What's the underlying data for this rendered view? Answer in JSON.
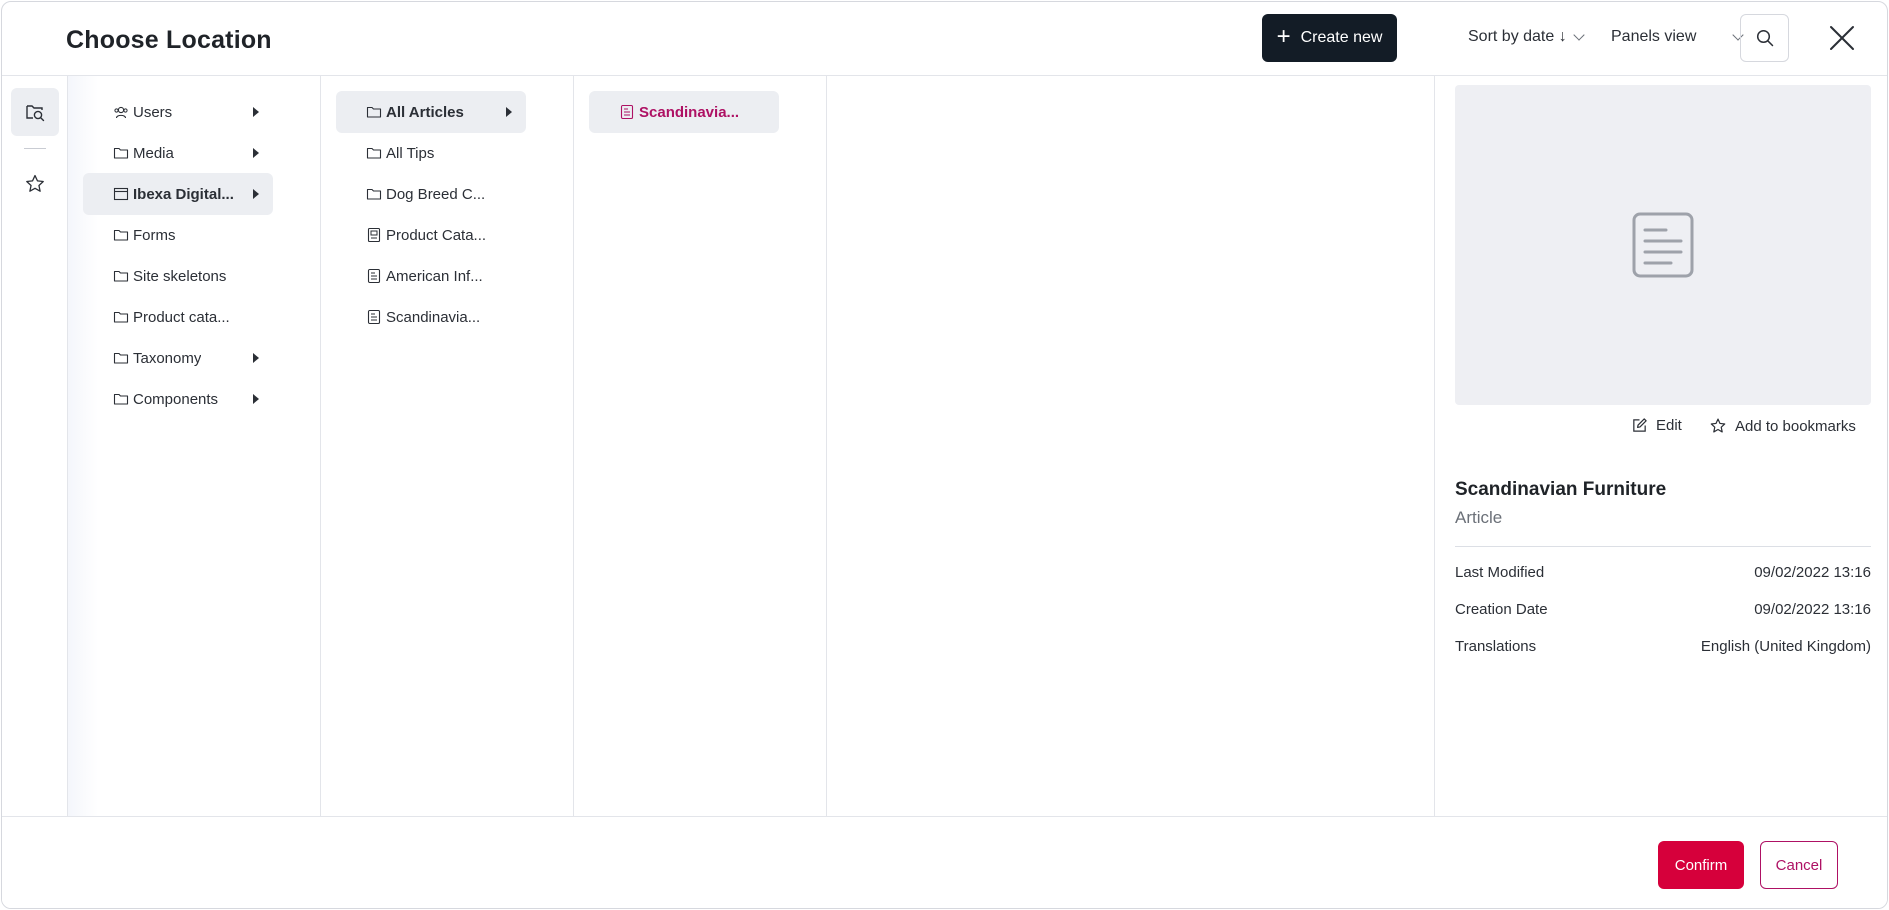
{
  "header": {
    "title": "Choose Location",
    "create_label": "Create new",
    "sort_label": "Sort by date ↓",
    "view_label": "Panels view"
  },
  "column1": [
    {
      "label": "Users",
      "icon": "user-group-icon",
      "arrow": true
    },
    {
      "label": "Media",
      "icon": "folder-icon",
      "arrow": true
    },
    {
      "label": "Ibexa Digital...",
      "icon": "site-icon",
      "arrow": true,
      "selected": true
    },
    {
      "label": "Forms",
      "icon": "folder-icon",
      "arrow": false
    },
    {
      "label": "Site skeletons",
      "icon": "folder-icon",
      "arrow": false
    },
    {
      "label": "Product cata...",
      "icon": "folder-icon",
      "arrow": false
    },
    {
      "label": "Taxonomy",
      "icon": "folder-icon",
      "arrow": true
    },
    {
      "label": "Components",
      "icon": "folder-icon",
      "arrow": true
    }
  ],
  "column2": [
    {
      "label": "All Articles",
      "icon": "folder-icon",
      "arrow": true,
      "selected": true
    },
    {
      "label": "All Tips",
      "icon": "folder-icon",
      "arrow": false
    },
    {
      "label": "Dog Breed C...",
      "icon": "folder-icon",
      "arrow": false
    },
    {
      "label": "Product Cata...",
      "icon": "catalog-icon",
      "arrow": false
    },
    {
      "label": "American Inf...",
      "icon": "article-icon",
      "arrow": false
    },
    {
      "label": "Scandinavia...",
      "icon": "article-icon",
      "arrow": false
    }
  ],
  "column3": [
    {
      "label": "Scandinavia...",
      "icon": "article-icon",
      "arrow": false,
      "active": true
    }
  ],
  "preview": {
    "edit_label": "Edit",
    "bookmark_label": "Add to bookmarks",
    "name": "Scandinavian Furniture",
    "type": "Article",
    "meta": [
      {
        "label": "Last Modified",
        "value": "09/02/2022 13:16"
      },
      {
        "label": "Creation Date",
        "value": "09/02/2022 13:16"
      },
      {
        "label": "Translations",
        "value": "English (United Kingdom)"
      }
    ]
  },
  "footer": {
    "confirm_label": "Confirm",
    "cancel_label": "Cancel"
  },
  "colors": {
    "accent": "#ae1164",
    "confirm": "#d6003b",
    "create_bg": "#131c26"
  }
}
